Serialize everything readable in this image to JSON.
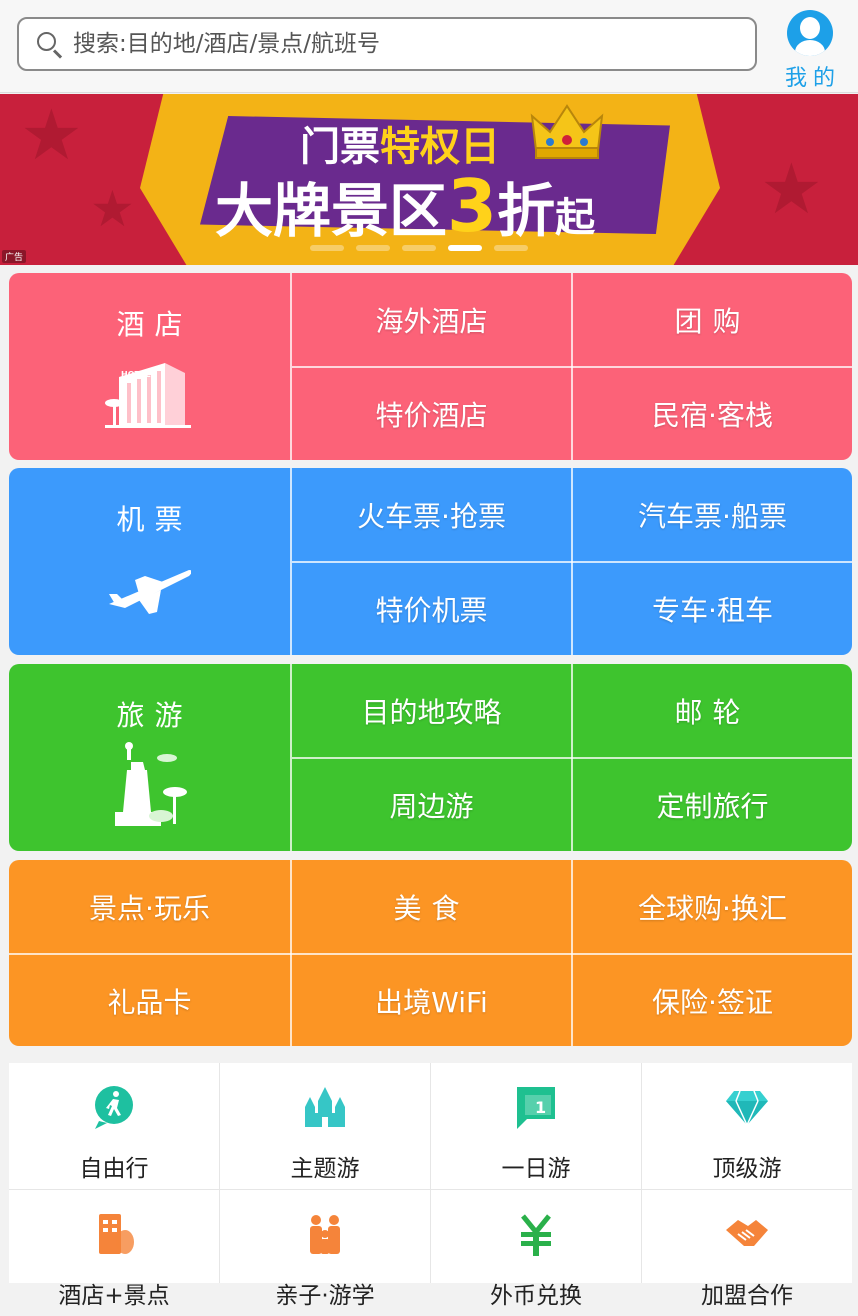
{
  "search": {
    "placeholder": "搜索:目的地/酒店/景点/航班号"
  },
  "profile": {
    "label": "我的"
  },
  "banner": {
    "line1_a": "门票",
    "line1_b": "特权日",
    "line2_a": "大牌景区",
    "line2_num": "3",
    "line2_b": "折",
    "line2_c": "起",
    "ad_tag": "广告",
    "dots": 5,
    "active_dot": 3
  },
  "blocks": {
    "hotel": {
      "title": "酒店",
      "items": [
        "海外酒店",
        "团购",
        "特价酒店",
        "民宿·客栈"
      ],
      "color": "#fc6278"
    },
    "flight": {
      "title": "机票",
      "items": [
        "火车票·抢票",
        "汽车票·船票",
        "特价机票",
        "专车·租车"
      ],
      "color": "#3c9afc"
    },
    "travel": {
      "title": "旅游",
      "items": [
        "目的地攻略",
        "邮轮",
        "周边游",
        "定制旅行"
      ],
      "color": "#3ec42e"
    },
    "fun": {
      "items": [
        "景点·玩乐",
        "美食",
        "全球购·换汇",
        "礼品卡",
        "出境WiFi",
        "保险·签证"
      ],
      "color": "#fc9524"
    }
  },
  "shortcuts": [
    {
      "label": "自由行",
      "icon": "walker-icon"
    },
    {
      "label": "主题游",
      "icon": "castle-icon"
    },
    {
      "label": "一日游",
      "icon": "calendar-one-icon"
    },
    {
      "label": "顶级游",
      "icon": "diamond-icon"
    },
    {
      "label": "酒店+景点",
      "icon": "hotel-scenic-icon"
    },
    {
      "label": "亲子·游学",
      "icon": "family-icon"
    },
    {
      "label": "外币兑换",
      "icon": "yuan-icon"
    },
    {
      "label": "加盟合作",
      "icon": "handshake-icon"
    }
  ]
}
